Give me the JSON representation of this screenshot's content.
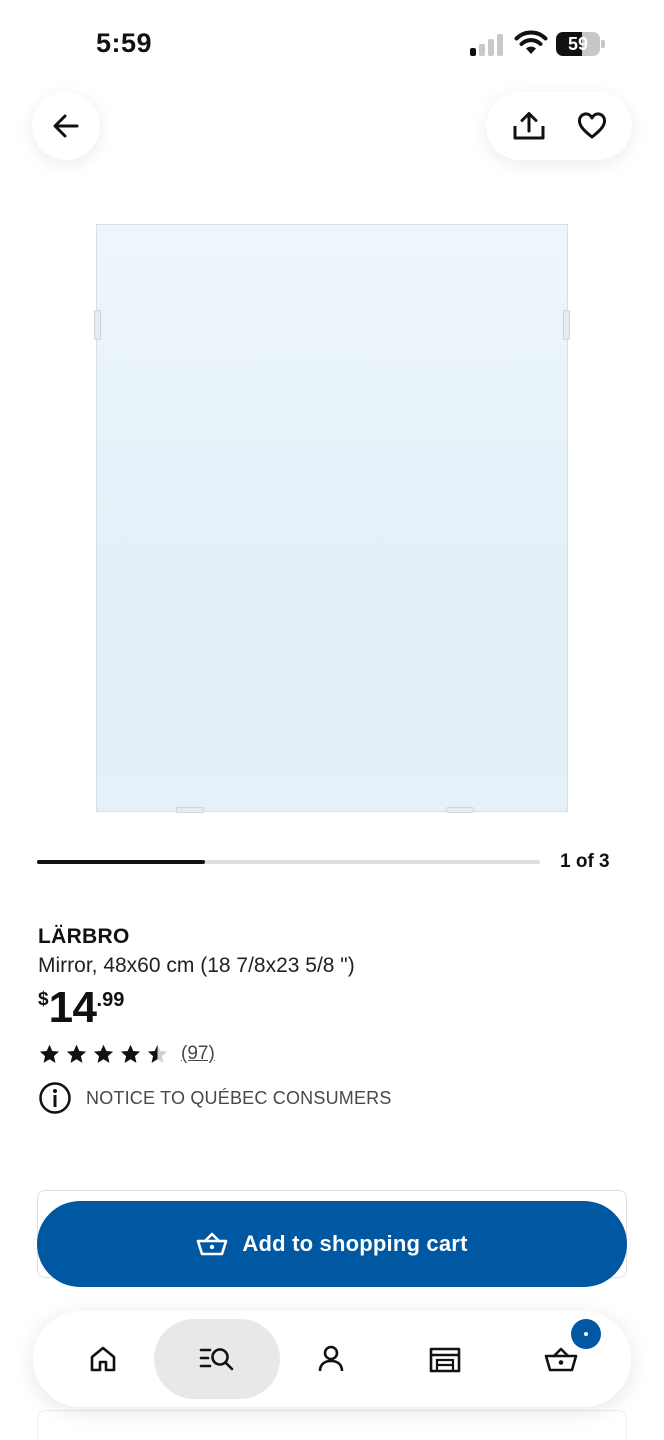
{
  "status_bar": {
    "time": "5:59",
    "battery_level": "59",
    "battery_fraction": 0.59,
    "signal_bars_active": 1,
    "signal_bars_total": 4
  },
  "top_actions": {
    "back_icon": "arrow-left-icon",
    "share_icon": "share-icon",
    "favorite_icon": "heart-icon"
  },
  "carousel": {
    "counter": "1 of 3",
    "current": 1,
    "total": 3
  },
  "product": {
    "name": "LÄRBRO",
    "description": "Mirror, 48x60 cm (18 7/8x23 5/8 \")",
    "price": {
      "currency": "$",
      "whole": "14",
      "cents": ".99"
    },
    "rating": {
      "value": 4.5,
      "max": 5,
      "review_count": "(97)"
    },
    "notice": "NOTICE TO QUÉBEC CONSUMERS"
  },
  "cart_button": {
    "label": "Add to shopping cart",
    "icon": "basket-icon"
  },
  "bottom_nav": {
    "items": [
      {
        "name": "home",
        "icon": "home-icon"
      },
      {
        "name": "search",
        "icon": "search-icon",
        "active": true
      },
      {
        "name": "profile",
        "icon": "user-icon"
      },
      {
        "name": "store",
        "icon": "store-icon"
      },
      {
        "name": "cart",
        "icon": "basket-icon"
      }
    ]
  },
  "colors": {
    "brand_blue": "#0058a3",
    "text": "#111111",
    "muted": "#484848"
  }
}
